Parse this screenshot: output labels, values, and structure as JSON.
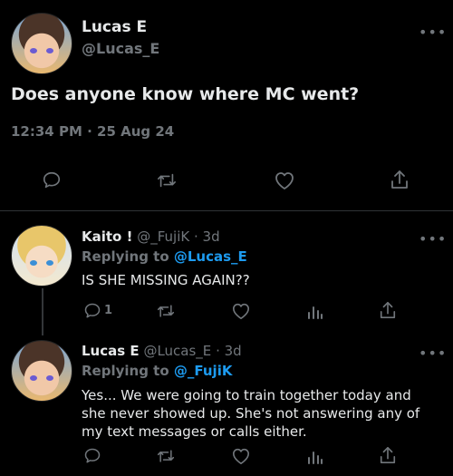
{
  "main_tweet": {
    "display_name": "Lucas E",
    "handle": "@Lucas_E",
    "text": "Does anyone know where MC went?",
    "timestamp": "12:34 PM · 25 Aug 24"
  },
  "replies": [
    {
      "display_name": "Kaito !",
      "handle": "@_FujiK",
      "age": "· 3d",
      "replying_to_label": "Replying to",
      "replying_to_handle": "@Lucas_E",
      "text": "IS SHE MISSING AGAIN??",
      "reply_count": "1"
    },
    {
      "display_name": "Lucas E",
      "handle": "@Lucas_E",
      "age": "· 3d",
      "replying_to_label": "Replying to",
      "replying_to_handle": "@_FujiK",
      "text": "Yes... We were going to train together today and she never showed up. She's not answering any of my text messages or calls either."
    }
  ],
  "icons": {
    "more": "more-icon",
    "reply": "reply-icon",
    "retweet": "retweet-icon",
    "like": "like-icon",
    "analytics": "analytics-icon",
    "share": "share-icon"
  },
  "colors": {
    "background": "#000000",
    "text": "#e7e9ea",
    "muted": "#71767b",
    "link": "#1d9bf0",
    "divider": "#2f3336"
  }
}
